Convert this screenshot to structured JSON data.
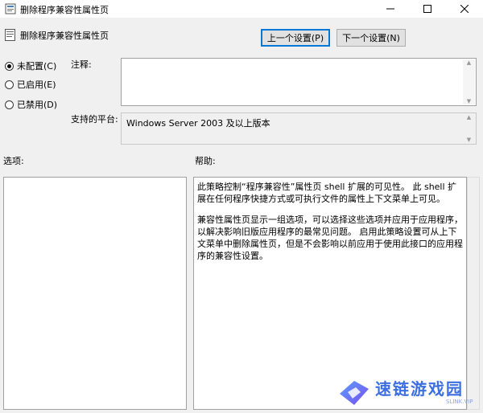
{
  "window": {
    "title": "删除程序兼容性属性页",
    "controls": {
      "minimize": "—",
      "maximize": "☐",
      "close": "✕"
    }
  },
  "header": {
    "policy_name": "删除程序兼容性属性页",
    "prev_button": "上一个设置(P)",
    "next_button": "下一个设置(N)"
  },
  "state": {
    "options": [
      {
        "label": "未配置(C)",
        "selected": true
      },
      {
        "label": "已启用(E)",
        "selected": false
      },
      {
        "label": "已禁用(D)",
        "selected": false
      }
    ]
  },
  "comment": {
    "label": "注释:",
    "value": ""
  },
  "platform": {
    "label": "支持的平台:",
    "value": "Windows Server 2003 及以上版本"
  },
  "options_section": {
    "label": "选项:"
  },
  "help_section": {
    "label": "帮助:",
    "paragraphs": [
      "此策略控制“程序兼容性”属性页 shell 扩展的可见性。 此 shell 扩展在任何程序快捷方式或可执行文件的属性上下文菜单上可见。",
      "兼容性属性页显示一组选项，可以选择这些选项并应用于应用程序，以解决影响旧版应用程序的最常见问题。 启用此策略设置可从上下文菜单中删除属性页，但是不会影响以前应用于使用此接口的应用程序的兼容性设置。"
    ]
  },
  "watermark": {
    "text": "速链游戏园",
    "sub": "SLINK.VIP"
  },
  "icons": {
    "title": "policy-settings-icon",
    "header": "policy-document-icon"
  }
}
